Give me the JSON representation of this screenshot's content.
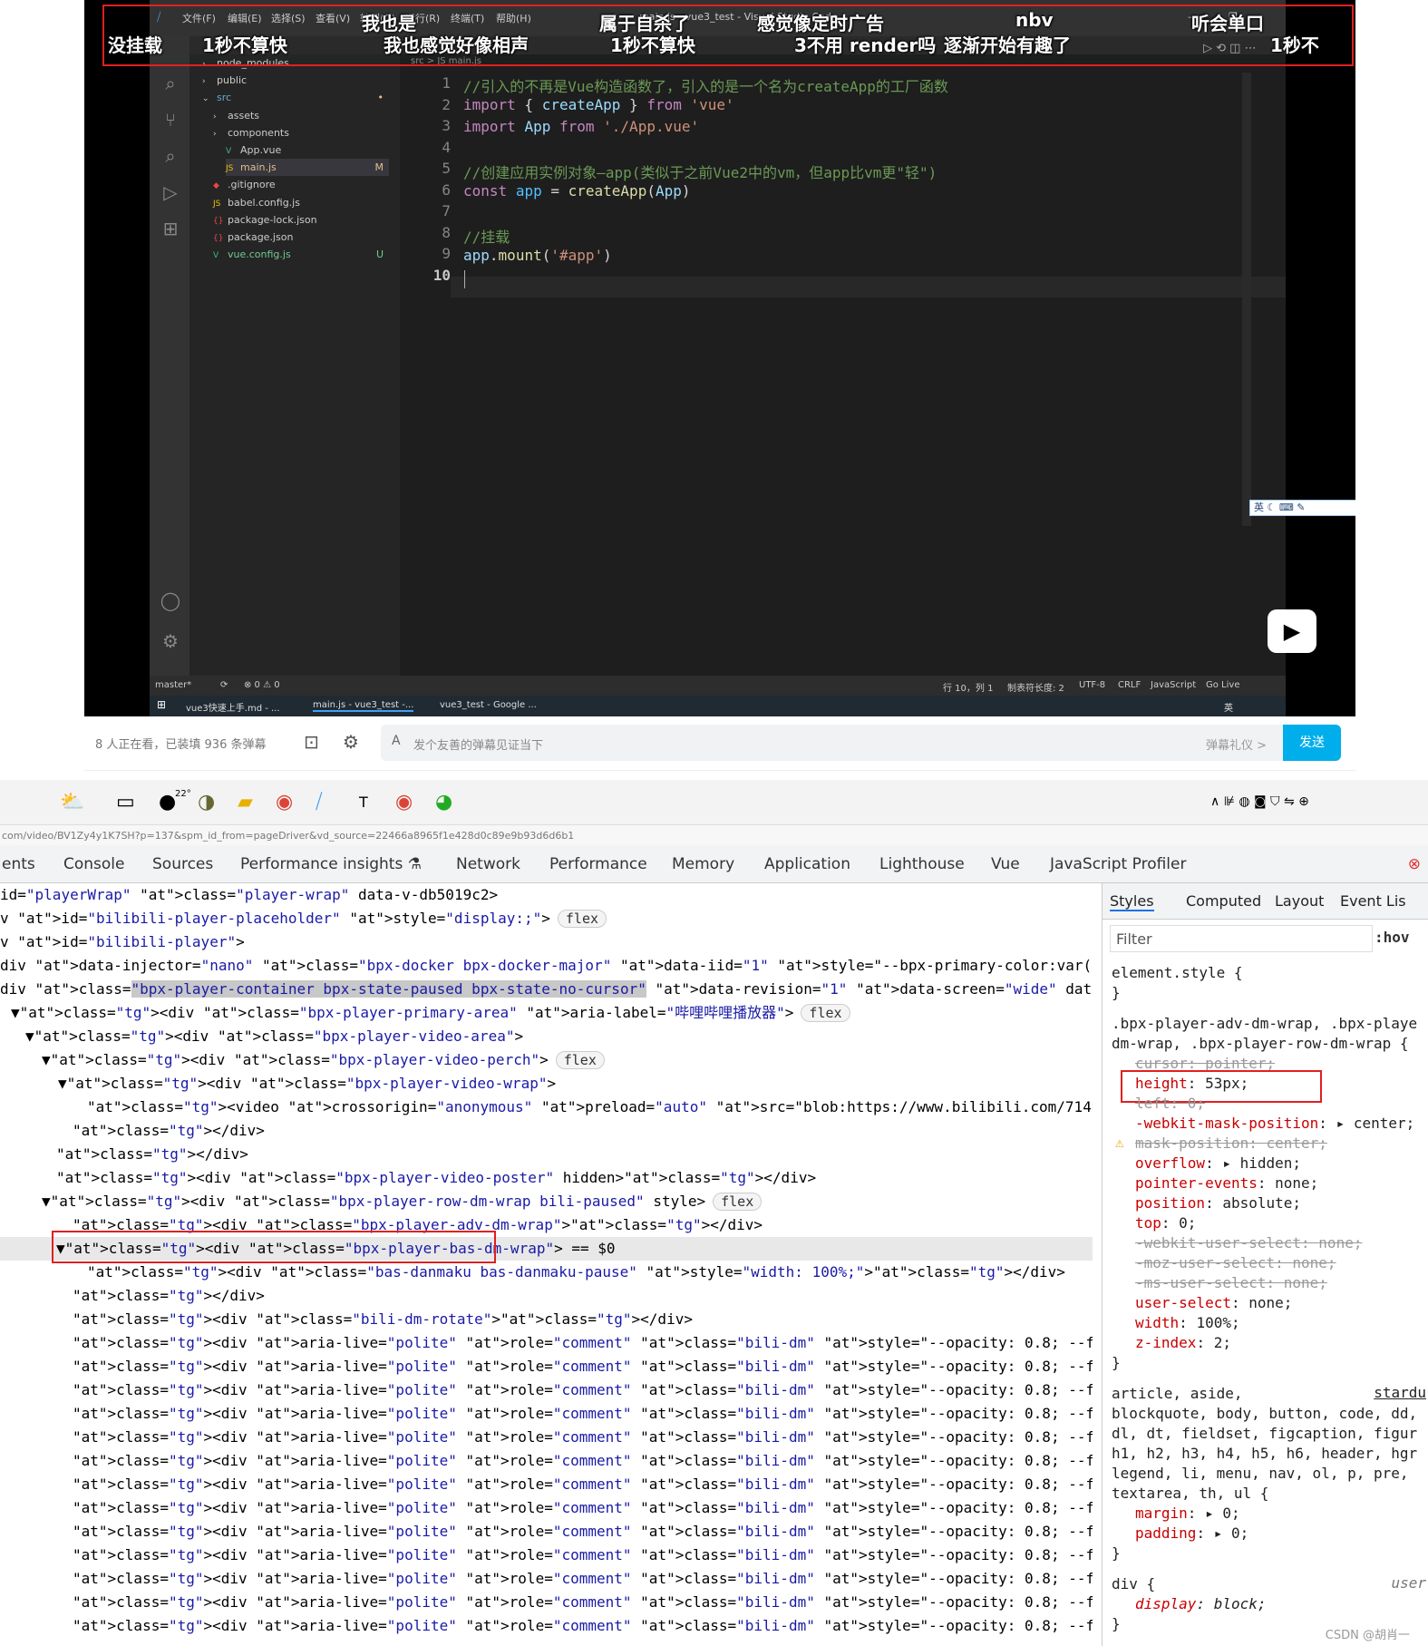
{
  "player": {
    "titlebar": {
      "app_icon": "vscode-icon",
      "menus": [
        "文件(F)",
        "编辑(E)",
        "选择(S)",
        "查看(V)",
        "转到(G)",
        "运行(R)",
        "终端(T)",
        "帮助(H)"
      ],
      "title": "main.js - vue3_test - Visual Studio Code",
      "minimize": "–",
      "restore": "❐"
    },
    "danmaku": [
      "没挂载",
      "1秒不算快",
      "我也是",
      "我也感觉好像相声",
      "属于自杀了",
      "1秒不算快",
      "感觉像定时广告",
      "3不用 render吗",
      "逐渐开始有趣了",
      "nbv",
      "听会单口",
      "1秒不"
    ],
    "explorer": [
      {
        "name": "node_modules",
        "badge": "",
        "type": "folder"
      },
      {
        "name": "public",
        "badge": "",
        "type": "folder"
      },
      {
        "name": "src",
        "badge": "•",
        "type": "folder-open"
      },
      {
        "name": "assets",
        "badge": "",
        "type": "folder"
      },
      {
        "name": "components",
        "badge": "",
        "type": "folder"
      },
      {
        "name": "App.vue",
        "badge": "",
        "type": "vue"
      },
      {
        "name": "main.js",
        "badge": "M",
        "type": "js"
      },
      {
        "name": ".gitignore",
        "badge": "",
        "type": "git"
      },
      {
        "name": "babel.config.js",
        "badge": "",
        "type": "js"
      },
      {
        "name": "package-lock.json",
        "badge": "",
        "type": "json"
      },
      {
        "name": "package.json",
        "badge": "",
        "type": "json"
      },
      {
        "name": "vue.config.js",
        "badge": "U",
        "type": "vue"
      }
    ],
    "breadcrumb": "src > JS main.js",
    "code": {
      "line_numbers": [
        "1",
        "2",
        "3",
        "4",
        "5",
        "6",
        "7",
        "8",
        "9",
        "10"
      ],
      "l1": "//引入的不再是Vue构造函数了，引入的是一个名为createApp的工厂函数",
      "l2": [
        "import",
        " { ",
        "createApp",
        " } ",
        "from",
        " ",
        "'vue'"
      ],
      "l3": [
        "import",
        " ",
        "App",
        " ",
        "from",
        " ",
        "'./App.vue'"
      ],
      "l5": "//创建应用实例对象—app(类似于之前Vue2中的vm，但app比vm更\"轻\")",
      "l6": [
        "const",
        " ",
        "app",
        " = ",
        "createApp",
        "(",
        "App",
        ")"
      ],
      "l8": "//挂载",
      "l9": [
        "app",
        ".",
        "mount",
        "(",
        "'#app'",
        ")"
      ]
    },
    "status": {
      "branch": "master*",
      "sync": "⟳",
      "problems": "⊗ 0 ⚠ 0",
      "position": "行 10，列 1",
      "tab": "制表符长度: 2",
      "encoding": "UTF-8",
      "eol": "CRLF",
      "lang": "JavaScript",
      "golive": "Go Live"
    },
    "taskbar": {
      "items": [
        "vue3快速上手.md - ...",
        "main.js - vue3_test -...",
        "vue3_test - Google ..."
      ],
      "ime": "英"
    },
    "ime_toolbar": "英"
  },
  "dm_bar": {
    "viewers": "8 人正在看，已装填 936 条弹幕",
    "placeholder": "发个友善的弹幕见证当下",
    "etiquette": "弹幕礼仪 >",
    "send": "发送"
  },
  "browser": {
    "url": "com/video/BV1Zy4y1K7SH?p=137&spm_id_from=pageDriver&vd_source=22466a8965f1e428d0c89e9b93d6d6b1",
    "tray_temp": "22°"
  },
  "devtools": {
    "tabs": [
      "ents",
      "Console",
      "Sources",
      "Performance insights",
      "Network",
      "Performance",
      "Memory",
      "Application",
      "Lighthouse",
      "Vue",
      "JavaScript Profiler"
    ],
    "close": "⊗",
    "dom_rows": [
      "id=\"playerWrap\" class=\"player-wrap\" data-v-db5019c2>",
      "v id=\"bilibili-player-placeholder\" style=\"display:;\">",
      "v id=\"bilibili-player\">",
      "div data-injector=\"nano\" class=\"bpx-docker bpx-docker-major\" data-iid=\"1\" style=\"--bpx-primary-color:var(--brand_blue); --",
      "div class=\"bpx-player-container bpx-state-paused bpx-state-no-cursor\" data-revision=\"1\" data-screen=\"wide\" data-ctrl-hid",
      "▼<div class=\"bpx-player-primary-area\" aria-label=\"哔哩哔哩播放器\">",
      "▼<div class=\"bpx-player-video-area\">",
      "▼<div class=\"bpx-player-video-perch\">",
      "▼<div class=\"bpx-player-video-wrap\">",
      "<video crossorigin=\"anonymous\" preload=\"auto\" src=\"blob:https://www.bilibili.com/714962aa-eca1-44c4-a906-3115e4d",
      "</div>",
      "</div>",
      "<div class=\"bpx-player-video-poster\" hidden></div>",
      "▼<div class=\"bpx-player-row-dm-wrap bili-paused\" style>",
      "<div class=\"bpx-player-adv-dm-wrap\"></div>",
      "▼<div class=\"bpx-player-bas-dm-wrap\"> == $0",
      "<div class=\"bas-danmaku bas-danmaku-pause\" style=\"width: 100%;\"></div>",
      "</div>",
      "<div class=\"bili-dm-rotate\"></div>"
    ],
    "comment_row": "<div aria-live=\"polite\" role=\"comment\" class=\"bili-dm\" style=\"--opacity: 0.8; --fontSize: 29.526px; --fontFamily:",
    "comment_count": 13,
    "pill_flex": "flex",
    "styles": {
      "tabs": [
        "Styles",
        "Computed",
        "Layout",
        "Event Lis"
      ],
      "filter_placeholder": "Filter",
      "hov": ":hov",
      "element_style": "element.style {",
      "close": "}",
      "rule1_selector": [
        ".bpx-player-adv-dm-wrap, .bpx-playe",
        "dm-wrap, .bpx-player-row-dm-wrap {"
      ],
      "rule1": [
        [
          "cursor",
          "pointer;",
          true
        ],
        [
          "height",
          "53px;",
          false
        ],
        [
          "left",
          "0;",
          true
        ],
        [
          "-webkit-mask-position",
          "▸ center;",
          false
        ],
        [
          "mask-position",
          "center;",
          true
        ],
        [
          "overflow",
          "▸ hidden;",
          false
        ],
        [
          "pointer-events",
          "none;",
          false
        ],
        [
          "position",
          "absolute;",
          false
        ],
        [
          "top",
          "0;",
          false
        ],
        [
          "-webkit-user-select",
          "none;",
          true
        ],
        [
          "-moz-user-select",
          "none;",
          true
        ],
        [
          "-ms-user-select",
          "none;",
          true
        ],
        [
          "user-select",
          "none;",
          false
        ],
        [
          "width",
          "100%;",
          false
        ],
        [
          "z-index",
          "2;",
          false
        ]
      ],
      "rule2_selector": [
        "article, aside,",
        "blockquote, body, button, code, dd,",
        "dl, dt, fieldset, figcaption, figur",
        "h1, h2, h3, h4, h5, h6, header, hgr",
        "legend, li, menu, nav, ol, p, pre,",
        "textarea, th, ul {"
      ],
      "rule2_source": "stardu",
      "rule2": [
        [
          "margin",
          "▸ 0;"
        ],
        [
          "padding",
          "▸ 0;"
        ]
      ],
      "rule3_selector": "div {",
      "rule3_source": "user",
      "rule3": [
        [
          "display",
          "block;"
        ]
      ]
    },
    "watermark": "CSDN @胡肖一"
  }
}
